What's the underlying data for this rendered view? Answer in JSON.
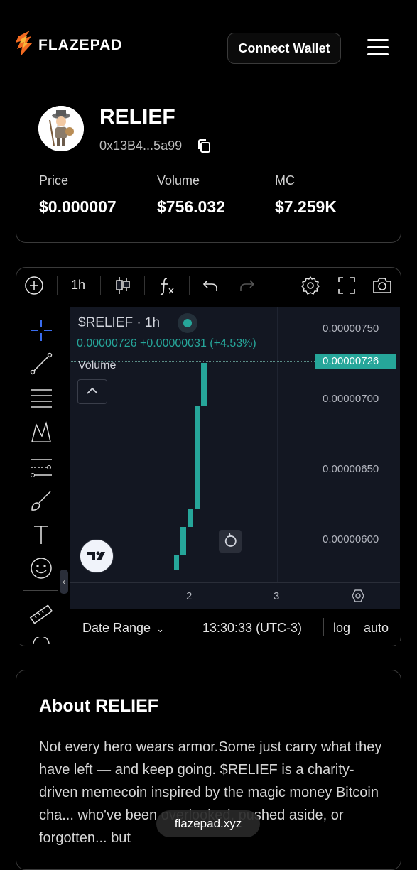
{
  "header": {
    "logo_text": "FLAZEPAD",
    "connect_label": "Connect Wallet"
  },
  "token": {
    "name": "RELIEF",
    "address": "0x13B4...5a99",
    "stats": [
      {
        "label": "Price",
        "value": "$0.000007"
      },
      {
        "label": "Volume",
        "value": "$756.032"
      },
      {
        "label": "MC",
        "value": "$7.259K"
      }
    ]
  },
  "chart": {
    "toolbar_interval": "1h",
    "symbol_line": "$RELIEF · 1h",
    "ohlc_line": "0.00000726 +0.00000031 (+4.53%)",
    "volume_label": "Volume",
    "last_price_label": "0.00000726",
    "date_range_label": "Date Range",
    "time_label": "13:30:33 (UTC-3)",
    "log_label": "log",
    "auto_label": "auto",
    "accent": "#26a69a"
  },
  "chart_data": {
    "type": "candlestick",
    "y_ticks": [
      "0.00000750",
      "0.00000700",
      "0.00000650",
      "0.00000600"
    ],
    "x_ticks": [
      "2",
      "3"
    ],
    "last_price": 7.26e-06,
    "candles": [
      {
        "open": 5.785e-06,
        "close": 5.79e-06
      },
      {
        "open": 5.785e-06,
        "close": 5.89e-06
      },
      {
        "open": 5.89e-06,
        "close": 6.09e-06
      },
      {
        "open": 6.09e-06,
        "close": 6.22e-06
      },
      {
        "open": 6.22e-06,
        "close": 6.95e-06
      },
      {
        "open": 6.95e-06,
        "close": 7.26e-06
      }
    ]
  },
  "about": {
    "title": "About RELIEF",
    "text": "Not every hero wears armor.Some just carry what they have left — and keep going. $RELIEF is a charity-driven memecoin inspired by the magic money Bitcoin cha... who've been overlooked, pushed aside, or forgotten... but"
  },
  "watermark": "flazepad.xyz"
}
